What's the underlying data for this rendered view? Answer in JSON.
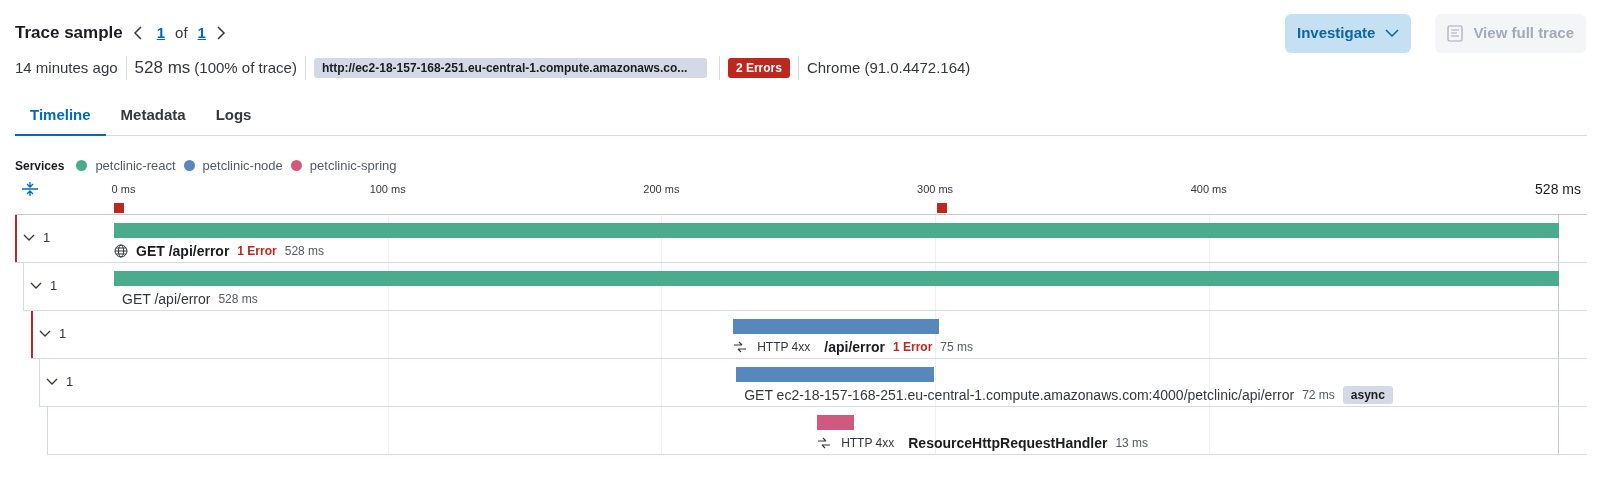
{
  "header": {
    "title": "Trace sample",
    "pager": {
      "current": "1",
      "of": "of",
      "total": "1"
    },
    "buttons": [
      {
        "label": "Investigate",
        "kind": "primary",
        "disabled": false
      },
      {
        "label": "View full trace",
        "kind": "icon",
        "disabled": true
      }
    ]
  },
  "summary": {
    "age": "14 minutes ago",
    "duration": "528 ms",
    "share": "(100% of trace)",
    "url": "http://ec2-18-157-168-251.eu-central-1.compute.amazonaws.co...",
    "errors": "2 Errors",
    "agent": "Chrome (91.0.4472.164)"
  },
  "tabs": [
    {
      "label": "Timeline",
      "selected": true
    },
    {
      "label": "Metadata",
      "selected": false
    },
    {
      "label": "Logs",
      "selected": false
    }
  ],
  "legend": {
    "title": "Services",
    "services": [
      {
        "name": "petclinic-react",
        "color": "#4aab8d"
      },
      {
        "name": "petclinic-node",
        "color": "#5688bb"
      },
      {
        "name": "petclinic-spring",
        "color": "#d05a7e"
      }
    ]
  },
  "axis": {
    "ticks": [
      "0 ms",
      "100 ms",
      "200 ms",
      "300 ms",
      "400 ms"
    ],
    "end_label": "528 ms"
  },
  "spans": [
    {
      "kind": "page-load",
      "expanded": true,
      "child_count": "1",
      "error": true,
      "color": "#4aab8d",
      "name": "GET /api/error",
      "error_label": "1 Error",
      "duration": "528 ms",
      "children": [
        {
          "kind": "transaction",
          "expanded": true,
          "child_count": "1",
          "error": false,
          "color": "#4aab8d",
          "name": "GET /api/error",
          "duration": "528 ms",
          "children": [
            {
              "kind": "exit-span",
              "expanded": true,
              "child_count": "1",
              "error": true,
              "color": "#5688bb",
              "prefix": "HTTP 4xx",
              "name": "/api/error",
              "error_label": "1 Error",
              "duration": "75 ms",
              "children": [
                {
                  "kind": "span",
                  "expanded": true,
                  "child_count": "1",
                  "error": false,
                  "color": "#5688bb",
                  "name": "GET ec2-18-157-168-251.eu-central-1.compute.amazonaws.com:4000/petclinic/api/error",
                  "duration": "72 ms",
                  "badge": "async",
                  "children": [
                    {
                      "kind": "exit-span",
                      "error": false,
                      "color": "#d05a7e",
                      "prefix": "HTTP 4xx",
                      "name": "ResourceHttpRequestHandler",
                      "duration": "13 ms"
                    }
                  ]
                }
              ]
            }
          ]
        }
      ]
    }
  ]
}
